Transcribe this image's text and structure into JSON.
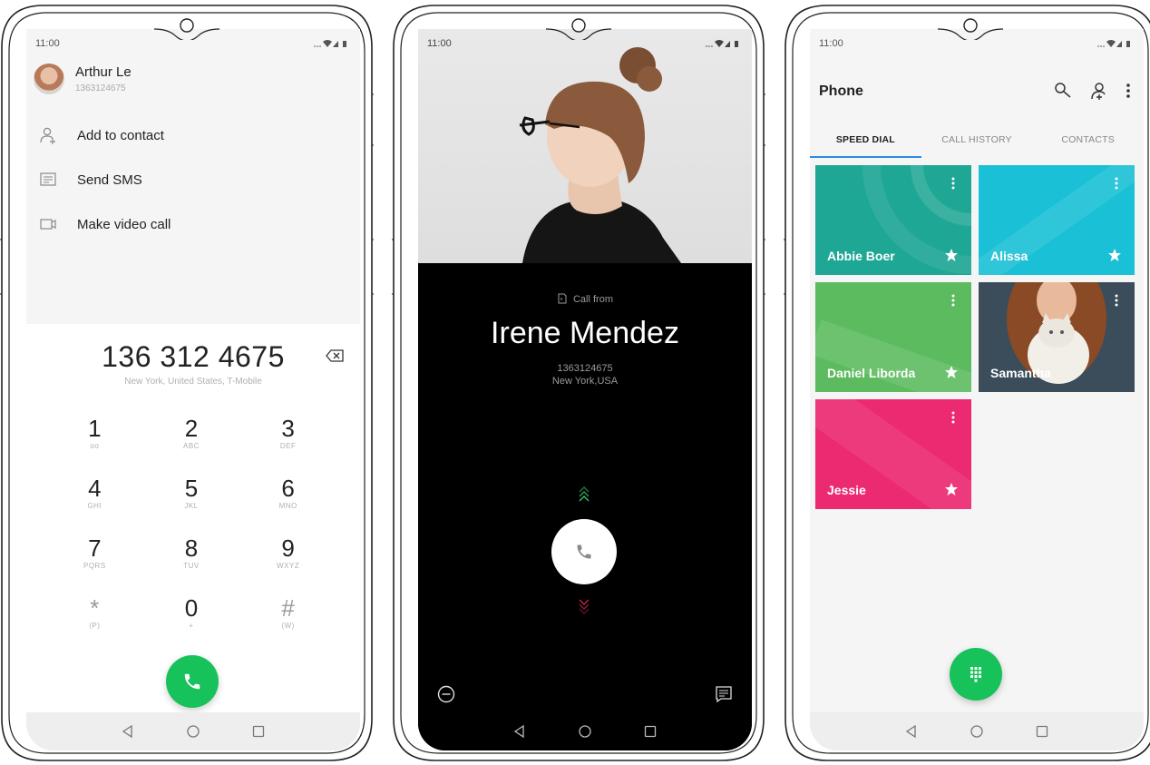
{
  "phone1": {
    "status": {
      "time": "11:00"
    },
    "contact": {
      "name": "Arthur Le",
      "number": "1363124675"
    },
    "menu": [
      {
        "label": "Add to contact",
        "icon": "add-contact-icon"
      },
      {
        "label": "Send SMS",
        "icon": "message-icon"
      },
      {
        "label": "Make video call",
        "icon": "video-icon"
      }
    ],
    "dialer": {
      "number": "136 312 4675",
      "location": "New York, United States, T-Mobile",
      "keys": [
        {
          "digit": "1",
          "letters": "oo"
        },
        {
          "digit": "2",
          "letters": "ABC"
        },
        {
          "digit": "3",
          "letters": "DEF"
        },
        {
          "digit": "4",
          "letters": "GHI"
        },
        {
          "digit": "5",
          "letters": "JKL"
        },
        {
          "digit": "6",
          "letters": "MNO"
        },
        {
          "digit": "7",
          "letters": "PQRS"
        },
        {
          "digit": "8",
          "letters": "TUV"
        },
        {
          "digit": "9",
          "letters": "WXYZ"
        },
        {
          "digit": "*",
          "letters": "(P)"
        },
        {
          "digit": "0",
          "letters": "+"
        },
        {
          "digit": "#",
          "letters": "(W)"
        }
      ]
    }
  },
  "phone2": {
    "status": {
      "time": "11:00"
    },
    "call_from": "Call from",
    "caller_name": "Irene Mendez",
    "caller_number": "1363124675",
    "caller_location": "New York,USA"
  },
  "phone3": {
    "status": {
      "time": "11:00"
    },
    "title": "Phone",
    "tabs": [
      "SPEED DIAL",
      "CALL HISTORY",
      "CONTACTS"
    ],
    "active_tab": "SPEED DIAL",
    "tiles": [
      {
        "name": "Abbie Boer",
        "color": "#1fa795",
        "starred": true
      },
      {
        "name": "Alissa",
        "color": "#19c0d6",
        "starred": true
      },
      {
        "name": "Daniel Liborda",
        "color": "#5cbb5f",
        "starred": true
      },
      {
        "name": "Samantha",
        "color": "#2d3a45",
        "starred": false
      },
      {
        "name": "Jessie",
        "color": "#ec2a72",
        "starred": true
      }
    ]
  },
  "colors": {
    "accent_green": "#17c25a",
    "tab_underline": "#2b8de0"
  }
}
